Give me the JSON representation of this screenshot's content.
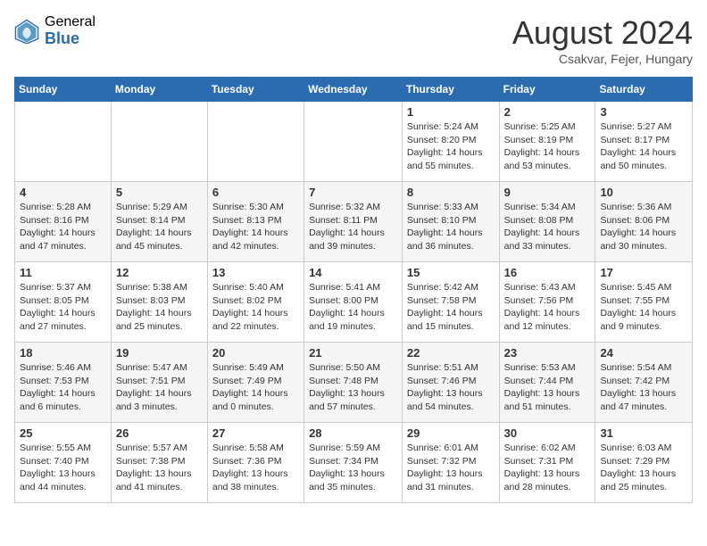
{
  "header": {
    "logo_general": "General",
    "logo_blue": "Blue",
    "month_title": "August 2024",
    "location": "Csakvar, Fejer, Hungary"
  },
  "weekdays": [
    "Sunday",
    "Monday",
    "Tuesday",
    "Wednesday",
    "Thursday",
    "Friday",
    "Saturday"
  ],
  "weeks": [
    [
      {
        "day": "",
        "info": ""
      },
      {
        "day": "",
        "info": ""
      },
      {
        "day": "",
        "info": ""
      },
      {
        "day": "",
        "info": ""
      },
      {
        "day": "1",
        "info": "Sunrise: 5:24 AM\nSunset: 8:20 PM\nDaylight: 14 hours and 55 minutes."
      },
      {
        "day": "2",
        "info": "Sunrise: 5:25 AM\nSunset: 8:19 PM\nDaylight: 14 hours and 53 minutes."
      },
      {
        "day": "3",
        "info": "Sunrise: 5:27 AM\nSunset: 8:17 PM\nDaylight: 14 hours and 50 minutes."
      }
    ],
    [
      {
        "day": "4",
        "info": "Sunrise: 5:28 AM\nSunset: 8:16 PM\nDaylight: 14 hours and 47 minutes."
      },
      {
        "day": "5",
        "info": "Sunrise: 5:29 AM\nSunset: 8:14 PM\nDaylight: 14 hours and 45 minutes."
      },
      {
        "day": "6",
        "info": "Sunrise: 5:30 AM\nSunset: 8:13 PM\nDaylight: 14 hours and 42 minutes."
      },
      {
        "day": "7",
        "info": "Sunrise: 5:32 AM\nSunset: 8:11 PM\nDaylight: 14 hours and 39 minutes."
      },
      {
        "day": "8",
        "info": "Sunrise: 5:33 AM\nSunset: 8:10 PM\nDaylight: 14 hours and 36 minutes."
      },
      {
        "day": "9",
        "info": "Sunrise: 5:34 AM\nSunset: 8:08 PM\nDaylight: 14 hours and 33 minutes."
      },
      {
        "day": "10",
        "info": "Sunrise: 5:36 AM\nSunset: 8:06 PM\nDaylight: 14 hours and 30 minutes."
      }
    ],
    [
      {
        "day": "11",
        "info": "Sunrise: 5:37 AM\nSunset: 8:05 PM\nDaylight: 14 hours and 27 minutes."
      },
      {
        "day": "12",
        "info": "Sunrise: 5:38 AM\nSunset: 8:03 PM\nDaylight: 14 hours and 25 minutes."
      },
      {
        "day": "13",
        "info": "Sunrise: 5:40 AM\nSunset: 8:02 PM\nDaylight: 14 hours and 22 minutes."
      },
      {
        "day": "14",
        "info": "Sunrise: 5:41 AM\nSunset: 8:00 PM\nDaylight: 14 hours and 19 minutes."
      },
      {
        "day": "15",
        "info": "Sunrise: 5:42 AM\nSunset: 7:58 PM\nDaylight: 14 hours and 15 minutes."
      },
      {
        "day": "16",
        "info": "Sunrise: 5:43 AM\nSunset: 7:56 PM\nDaylight: 14 hours and 12 minutes."
      },
      {
        "day": "17",
        "info": "Sunrise: 5:45 AM\nSunset: 7:55 PM\nDaylight: 14 hours and 9 minutes."
      }
    ],
    [
      {
        "day": "18",
        "info": "Sunrise: 5:46 AM\nSunset: 7:53 PM\nDaylight: 14 hours and 6 minutes."
      },
      {
        "day": "19",
        "info": "Sunrise: 5:47 AM\nSunset: 7:51 PM\nDaylight: 14 hours and 3 minutes."
      },
      {
        "day": "20",
        "info": "Sunrise: 5:49 AM\nSunset: 7:49 PM\nDaylight: 14 hours and 0 minutes."
      },
      {
        "day": "21",
        "info": "Sunrise: 5:50 AM\nSunset: 7:48 PM\nDaylight: 13 hours and 57 minutes."
      },
      {
        "day": "22",
        "info": "Sunrise: 5:51 AM\nSunset: 7:46 PM\nDaylight: 13 hours and 54 minutes."
      },
      {
        "day": "23",
        "info": "Sunrise: 5:53 AM\nSunset: 7:44 PM\nDaylight: 13 hours and 51 minutes."
      },
      {
        "day": "24",
        "info": "Sunrise: 5:54 AM\nSunset: 7:42 PM\nDaylight: 13 hours and 47 minutes."
      }
    ],
    [
      {
        "day": "25",
        "info": "Sunrise: 5:55 AM\nSunset: 7:40 PM\nDaylight: 13 hours and 44 minutes."
      },
      {
        "day": "26",
        "info": "Sunrise: 5:57 AM\nSunset: 7:38 PM\nDaylight: 13 hours and 41 minutes."
      },
      {
        "day": "27",
        "info": "Sunrise: 5:58 AM\nSunset: 7:36 PM\nDaylight: 13 hours and 38 minutes."
      },
      {
        "day": "28",
        "info": "Sunrise: 5:59 AM\nSunset: 7:34 PM\nDaylight: 13 hours and 35 minutes."
      },
      {
        "day": "29",
        "info": "Sunrise: 6:01 AM\nSunset: 7:32 PM\nDaylight: 13 hours and 31 minutes."
      },
      {
        "day": "30",
        "info": "Sunrise: 6:02 AM\nSunset: 7:31 PM\nDaylight: 13 hours and 28 minutes."
      },
      {
        "day": "31",
        "info": "Sunrise: 6:03 AM\nSunset: 7:29 PM\nDaylight: 13 hours and 25 minutes."
      }
    ]
  ]
}
